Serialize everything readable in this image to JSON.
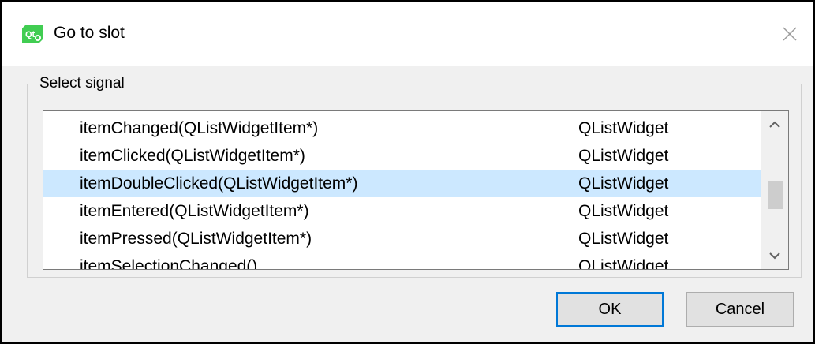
{
  "window": {
    "title": "Go to slot",
    "app_icon": "qt-creator-icon",
    "close_icon": "close-icon"
  },
  "group": {
    "title": "Select signal"
  },
  "signals": [
    {
      "signal": "itemChanged(QListWidgetItem*)",
      "class": "QListWidget",
      "selected": false
    },
    {
      "signal": "itemClicked(QListWidgetItem*)",
      "class": "QListWidget",
      "selected": false
    },
    {
      "signal": "itemDoubleClicked(QListWidgetItem*)",
      "class": "QListWidget",
      "selected": true
    },
    {
      "signal": "itemEntered(QListWidgetItem*)",
      "class": "QListWidget",
      "selected": false
    },
    {
      "signal": "itemPressed(QListWidgetItem*)",
      "class": "QListWidget",
      "selected": false
    },
    {
      "signal": "itemSelectionChanged()",
      "class": "QListWidget",
      "selected": false
    }
  ],
  "buttons": {
    "ok": "OK",
    "cancel": "Cancel"
  },
  "colors": {
    "selection": "#cce8ff",
    "focus_border": "#0078d7",
    "qt_green": "#41cd52"
  }
}
